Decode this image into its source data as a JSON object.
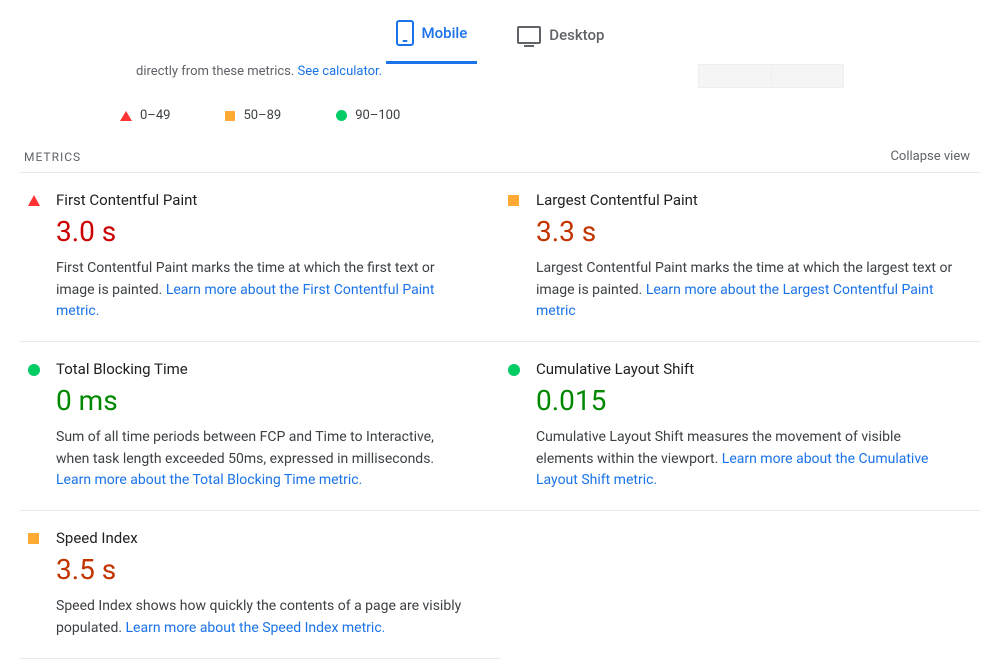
{
  "tabs": {
    "mobile": "Mobile",
    "desktop": "Desktop"
  },
  "topInfo": {
    "text": "directly from these metrics. ",
    "link": "See calculator."
  },
  "legend": {
    "red": "0–49",
    "orange": "50–89",
    "green": "90–100"
  },
  "sectionTitle": "METRICS",
  "collapseLabel": "Collapse view",
  "metrics": [
    {
      "shape": "tri",
      "title": "First Contentful Paint",
      "value": "3.0 s",
      "valueClass": "val-red",
      "desc": "First Contentful Paint marks the time at which the first text or image is painted. ",
      "link": "Learn more about the First Contentful Paint metric."
    },
    {
      "shape": "sq",
      "title": "Largest Contentful Paint",
      "value": "3.3 s",
      "valueClass": "val-orange",
      "desc": "Largest Contentful Paint marks the time at which the largest text or image is painted. ",
      "link": "Learn more about the Largest Contentful Paint metric"
    },
    {
      "shape": "cir",
      "title": "Total Blocking Time",
      "value": "0 ms",
      "valueClass": "val-green",
      "desc": "Sum of all time periods between FCP and Time to Interactive, when task length exceeded 50ms, expressed in milliseconds. ",
      "link": "Learn more about the Total Blocking Time metric."
    },
    {
      "shape": "cir",
      "title": "Cumulative Layout Shift",
      "value": "0.015",
      "valueClass": "val-green",
      "desc": "Cumulative Layout Shift measures the movement of visible elements within the viewport. ",
      "link": "Learn more about the Cumulative Layout Shift metric."
    },
    {
      "shape": "sq",
      "title": "Speed Index",
      "value": "3.5 s",
      "valueClass": "val-orange",
      "desc": "Speed Index shows how quickly the contents of a page are visibly populated. ",
      "link": "Learn more about the Speed Index metric."
    }
  ]
}
